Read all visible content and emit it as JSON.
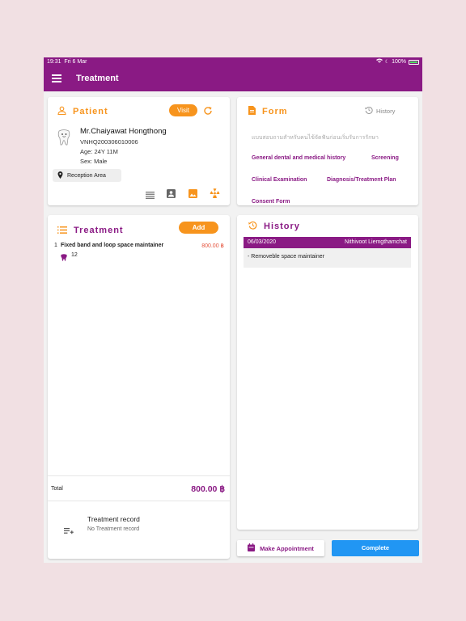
{
  "status": {
    "time": "19:31",
    "date": "Fri 6 Mar",
    "battery": "100%"
  },
  "appbar": {
    "title": "Treatment"
  },
  "patient": {
    "heading": "Patient",
    "visit_label": "Visit",
    "name": "Mr.Chaiyawat Hongthong",
    "hn": "VNHQ200306010006",
    "age": "Age: 24Y 11M",
    "sex": "Sex: Male",
    "location": "Reception Area"
  },
  "form": {
    "heading": "Form",
    "history_label": "History",
    "links": [
      "แบบสอบถามสำหรับคนไข้จัดฟันก่อนเริ่มรับการรักษา",
      "General dental and medical history",
      "Screening",
      "Clinical Examination",
      "Diagnosis/Treatment Plan",
      "Consent Form"
    ]
  },
  "treatment": {
    "heading": "Treatment",
    "add_label": "Add",
    "items": [
      {
        "index": "1",
        "name": "Fixed band and loop space maintainer",
        "price": "800.00 ฿",
        "tooth": "12"
      }
    ],
    "total_label": "Total",
    "total_value": "800.00 ฿",
    "record_title": "Treatment record",
    "record_empty": "No Treatment record"
  },
  "history": {
    "heading": "History",
    "date": "06/03/2020",
    "doctor": "Nithivoot Liemgthamchat",
    "entry": "- Removeble space maintainer"
  },
  "actions": {
    "appointment_label": "Make Appointment",
    "complete_label": "Complete"
  },
  "colors": {
    "brand": "#8a1a84",
    "accent": "#f7941d",
    "primary_button": "#2196f3"
  }
}
